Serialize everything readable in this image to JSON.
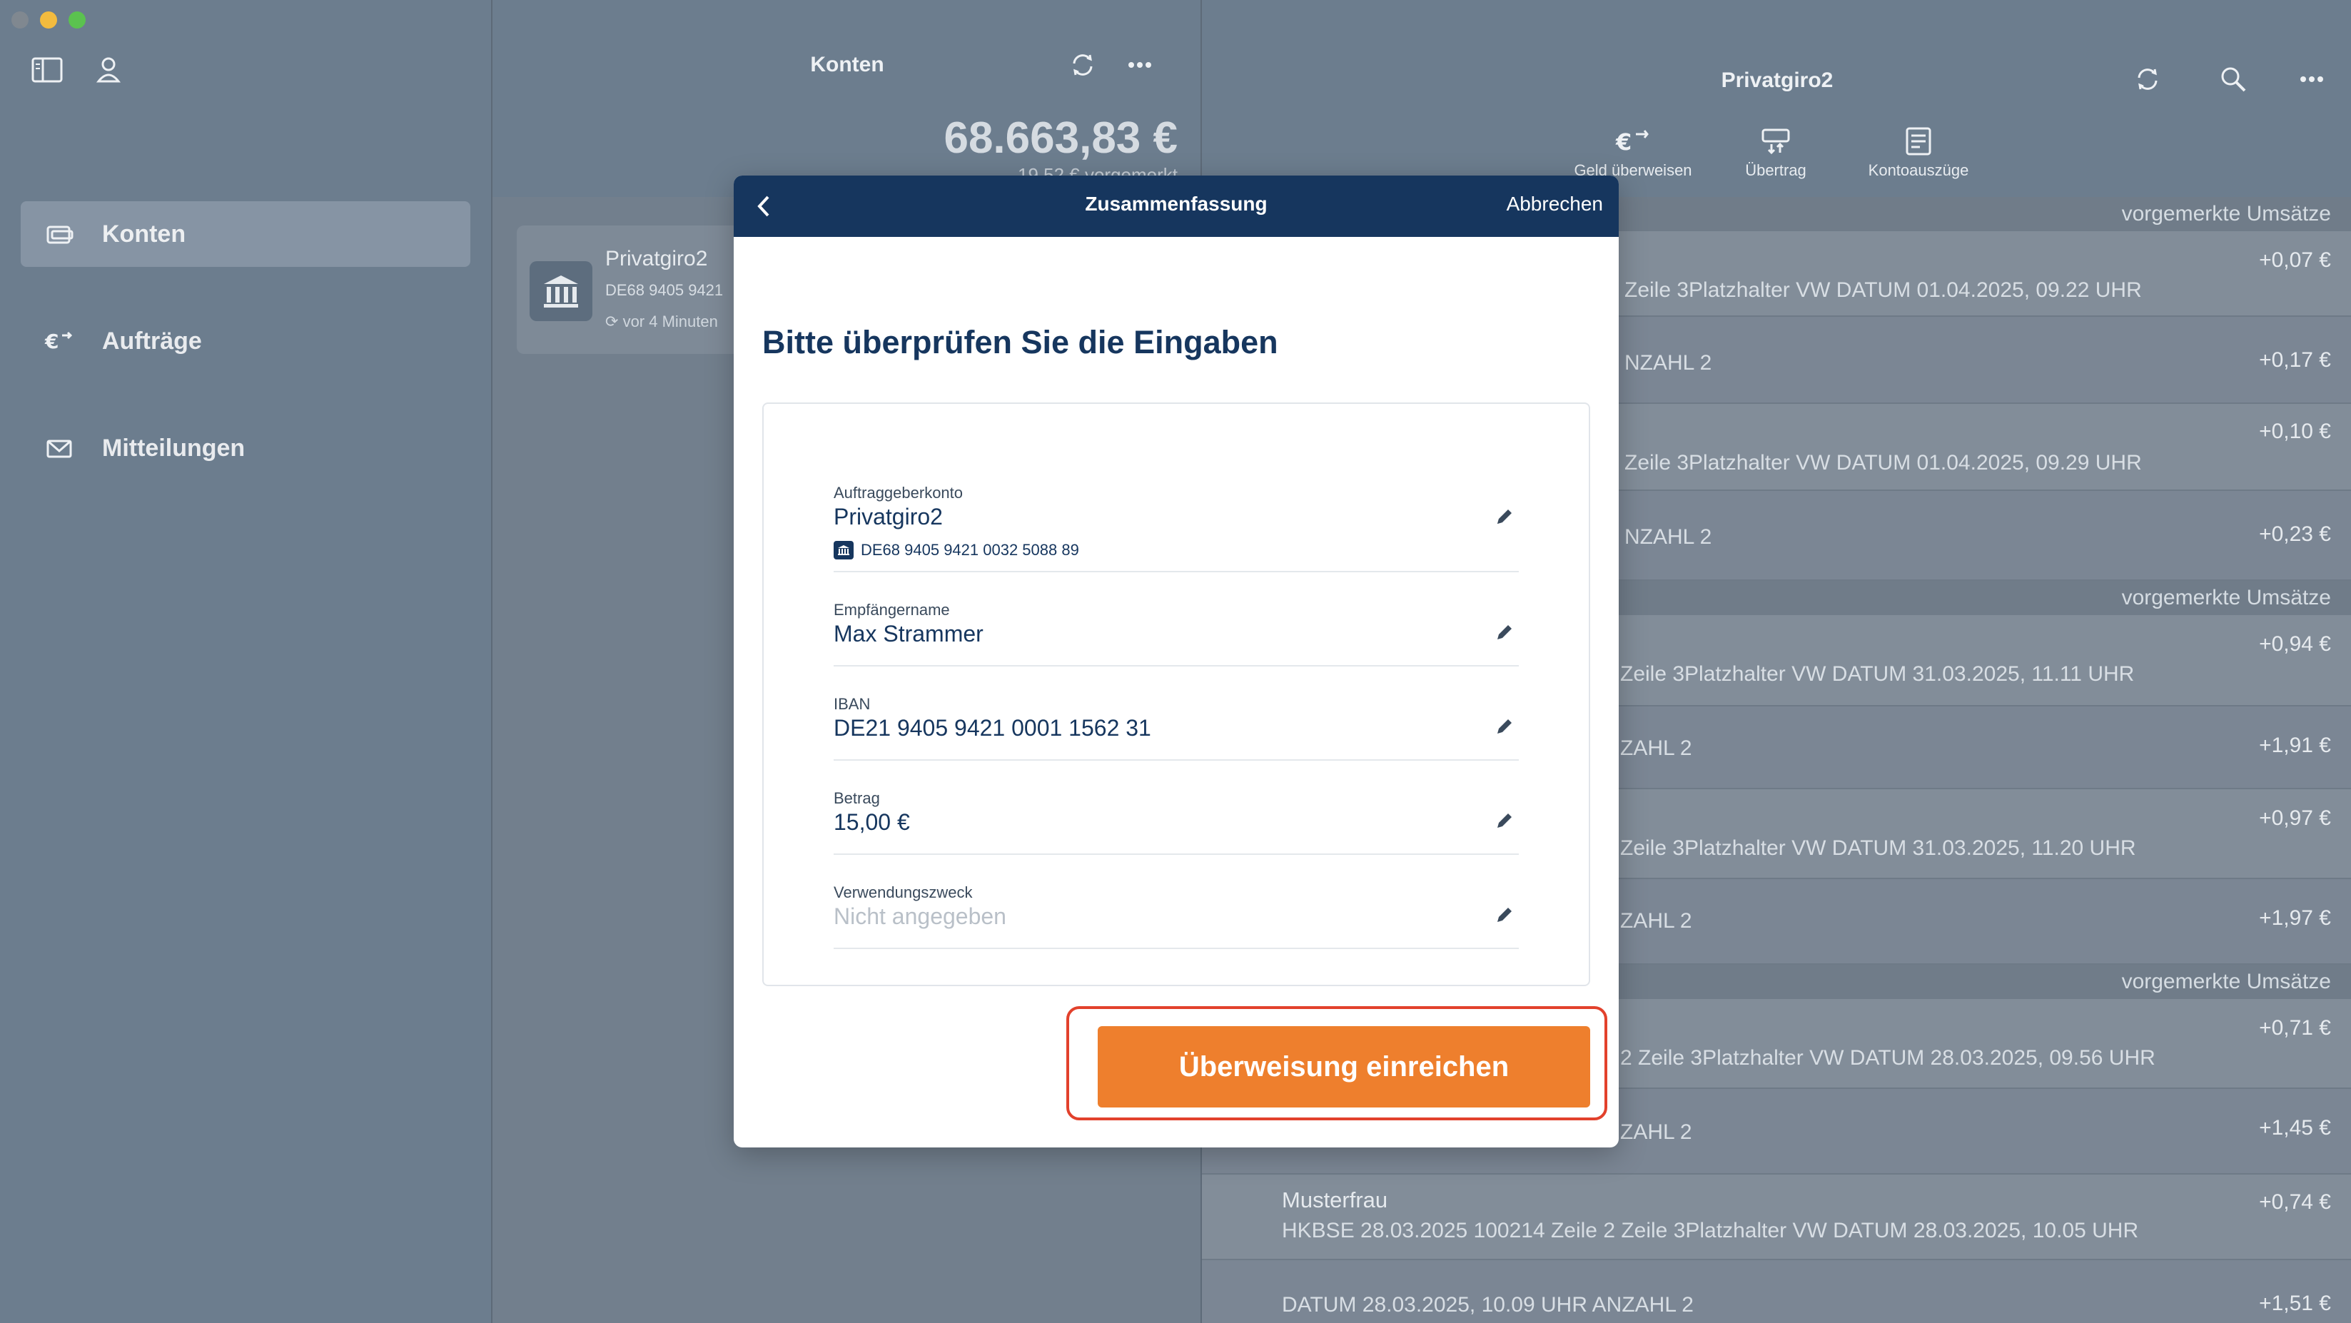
{
  "window": {
    "traffic_lights": [
      "#808890",
      "#f3bb3e",
      "#5bc24f"
    ]
  },
  "sidebar": {
    "items": [
      {
        "label": "Konten",
        "icon": "wallet-icon",
        "active": true
      },
      {
        "label": "Aufträge",
        "icon": "euro-transfer-icon",
        "active": false
      },
      {
        "label": "Mitteilungen",
        "icon": "mail-icon",
        "active": false
      }
    ]
  },
  "accounts": {
    "title": "Konten",
    "total": "68.663,83 €",
    "pending": "19,52 € vorgemerkt",
    "card": {
      "name": "Privatgiro2",
      "iban": "DE68 9405 9421",
      "sync": "vor 4 Minuten"
    }
  },
  "transactions": {
    "title": "Privatgiro2",
    "actions": [
      {
        "label": "Geld überweisen",
        "icon": "euro-transfer-icon"
      },
      {
        "label": "Übertrag",
        "icon": "transfer-icon"
      },
      {
        "label": "Kontoauszüge",
        "icon": "statement-icon"
      }
    ],
    "section_label": "vorgemerkte Umsätze",
    "rows": [
      {
        "desc": "Zeile 3Platzhalter VW DATUM 01.04.2025, 09.22 UHR",
        "amount": "+0,07 €"
      },
      {
        "desc": "NZAHL 2",
        "amount": "+0,17 €"
      },
      {
        "desc": "Zeile 3Platzhalter VW DATUM 01.04.2025, 09.29 UHR",
        "amount": "+0,10 €"
      },
      {
        "desc": "NZAHL 2",
        "amount": "+0,23 €"
      },
      {
        "desc": "Zeile 3Platzhalter VW DATUM 31.03.2025, 11.11 UHR",
        "amount": "+0,94 €"
      },
      {
        "desc": "ZAHL 2",
        "amount": "+1,91 €"
      },
      {
        "desc": "Zeile 3Platzhalter VW DATUM 31.03.2025, 11.20 UHR",
        "amount": "+0,97 €"
      },
      {
        "desc": "ZAHL 2",
        "amount": "+1,97 €"
      },
      {
        "desc": "2 Zeile 3Platzhalter VW DATUM 28.03.2025, 09.56 UHR",
        "amount": "+0,71 €"
      },
      {
        "desc": "ZAHL 2",
        "amount": "+1,45 €"
      },
      {
        "name": "Musterfrau",
        "desc": "HKBSE 28.03.2025 100214 Zeile 2 Zeile 3Platzhalter VW DATUM 28.03.2025, 10.05 UHR",
        "amount": "+0,74 €"
      },
      {
        "desc": "DATUM 28.03.2025, 10.09 UHR ANZAHL 2",
        "amount": "+1,51 €"
      }
    ]
  },
  "modal": {
    "title": "Zusammenfassung",
    "cancel": "Abbrechen",
    "heading": "Bitte überprüfen Sie die Eingaben",
    "fields": [
      {
        "label": "Auftraggeberkonto",
        "value": "Privatgiro2",
        "sub": "DE68 9405 9421 0032 5088 89"
      },
      {
        "label": "Empfängername",
        "value": "Max Strammer"
      },
      {
        "label": "IBAN",
        "value": "DE21 9405 9421 0001 1562 31"
      },
      {
        "label": "Betrag",
        "value": "15,00 €"
      },
      {
        "label": "Verwendungszweck",
        "value": "Nicht angegeben"
      }
    ],
    "submit": "Überweisung einreichen"
  },
  "colors": {
    "navy": "#16365e",
    "orange": "#ee7f2d",
    "highlight": "#e2412c"
  }
}
